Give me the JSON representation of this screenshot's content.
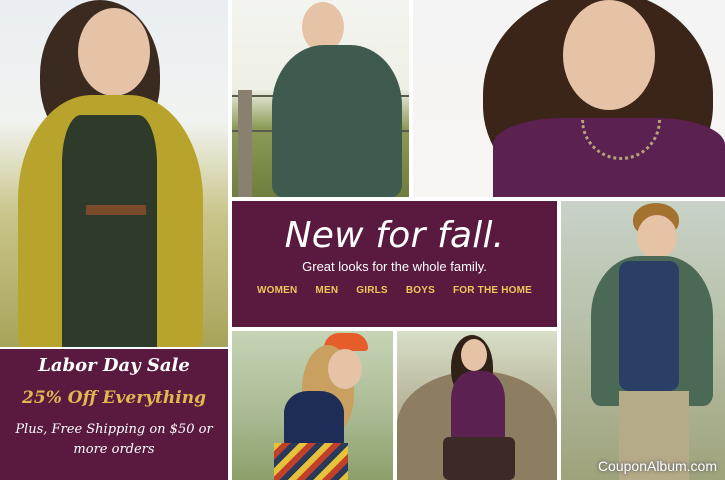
{
  "promo": {
    "title": "New for fall.",
    "subtitle": "Great looks for the whole family.",
    "nav": [
      {
        "label": "WOMEN"
      },
      {
        "label": "MEN"
      },
      {
        "label": "GIRLS"
      },
      {
        "label": "BOYS"
      },
      {
        "label": "FOR THE HOME"
      }
    ],
    "accent_color": "#f2c55a",
    "background_color": "#5a1a40"
  },
  "sale": {
    "headline": "Labor Day Sale",
    "offer": "25% Off Everything",
    "details": "Plus, Free Shipping on $50 or more orders",
    "offer_color": "#e2b650"
  },
  "watermark": {
    "text": "CouponAlbum.com"
  },
  "photos": [
    {
      "id": "woman-mustard-cardigan"
    },
    {
      "id": "man-plaid-shirt-fence"
    },
    {
      "id": "woman-purple-top-necklace"
    },
    {
      "id": "boy-plaid-vest"
    },
    {
      "id": "girl-orange-hat"
    },
    {
      "id": "woman-in-tree"
    }
  ]
}
